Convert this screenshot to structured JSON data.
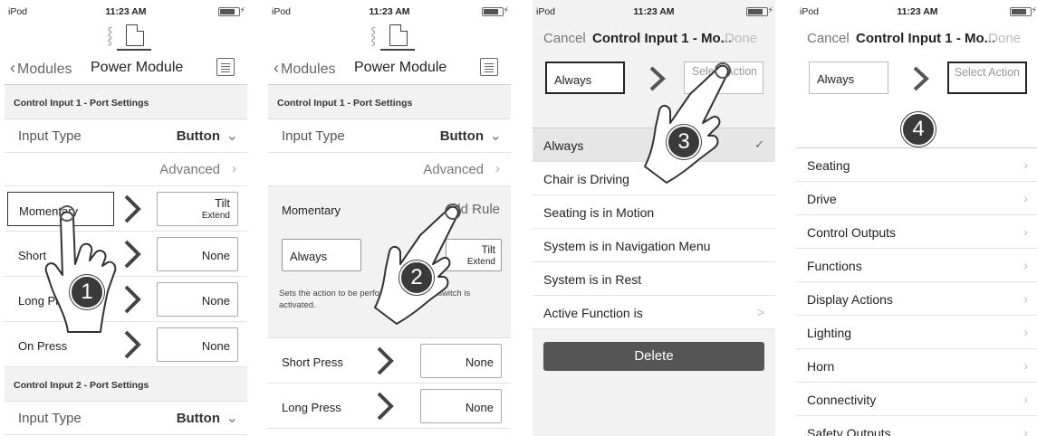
{
  "status": {
    "carrier": "iPod",
    "time": "11:23 AM",
    "bolt": "⚡"
  },
  "nav": {
    "back_label": "Modules",
    "title": "Power Module"
  },
  "panel1": {
    "section1": "Control Input 1 - Port Settings",
    "input_type_label": "Input Type",
    "input_type_value": "Button",
    "advanced_label": "Advanced",
    "rows": [
      {
        "label": "Momentary",
        "value": "Tilt",
        "sub": "Extend"
      },
      {
        "label": "Short",
        "value": "None",
        "sub": ""
      },
      {
        "label": "Long Pre",
        "value": "None",
        "sub": ""
      },
      {
        "label": "On Press",
        "value": "None",
        "sub": ""
      }
    ],
    "section2": "Control Input 2 - Port Settings",
    "input_type2_label": "Input Type",
    "input_type2_value": "Button",
    "badge": "1"
  },
  "panel2": {
    "section1": "Control Input 1 - Port Settings",
    "input_type_label": "Input Type",
    "input_type_value": "Button",
    "advanced_label": "Advanced",
    "momentary_label": "Momentary",
    "add_rule_label": "Add Rule",
    "always_label": "Always",
    "tilt_value": "Tilt",
    "tilt_sub": "Extend",
    "description": "Sets the action to be performed while the switch is activated.",
    "rows": [
      {
        "label": "Short Press",
        "value": "None"
      },
      {
        "label": "Long Press",
        "value": "None"
      }
    ],
    "badge": "2"
  },
  "panel3": {
    "cancel": "Cancel",
    "title": "Control Input 1 - Mo...",
    "done": "Done",
    "condition": "Always",
    "select_action": "Select Action",
    "items": [
      {
        "label": "Always",
        "right": "✓"
      },
      {
        "label": "Chair is Driving",
        "right": ""
      },
      {
        "label": "Seating is in Motion",
        "right": ""
      },
      {
        "label": "System is in Navigation Menu",
        "right": ""
      },
      {
        "label": "System is in Rest",
        "right": ""
      },
      {
        "label": "Active Function is",
        "right": ">"
      }
    ],
    "delete_label": "Delete",
    "badge": "3"
  },
  "panel4": {
    "cancel": "Cancel",
    "title": "Control Input 1 - Mo...",
    "done": "Done",
    "condition": "Always",
    "select_action": "Select Action",
    "items": [
      "Seating",
      "Drive",
      "Control Outputs",
      "Functions",
      "Display Actions",
      "Lighting",
      "Horn",
      "Connectivity",
      "Safety Outputs"
    ],
    "badge": "4"
  }
}
